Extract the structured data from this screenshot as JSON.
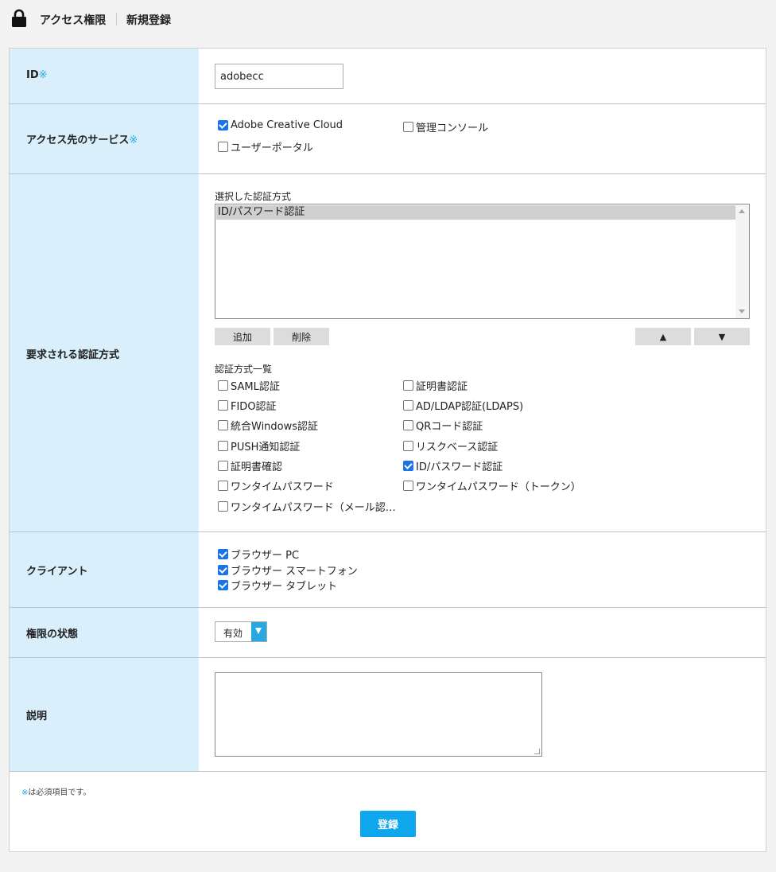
{
  "header": {
    "title": "アクセス権限",
    "subtitle": "新規登録"
  },
  "required_mark": "※",
  "id_row": {
    "label": "ID",
    "value": "adobecc"
  },
  "service_row": {
    "label": "アクセス先のサービス",
    "options": [
      {
        "label": "Adobe Creative Cloud",
        "checked": true
      },
      {
        "label": "管理コンソール",
        "checked": false
      },
      {
        "label": "ユーザーポータル",
        "checked": false
      }
    ]
  },
  "auth_row": {
    "label": "要求される認証方式",
    "selected_title": "選択した認証方式",
    "selected_items": [
      "ID/パスワード認証"
    ],
    "add_label": "追加",
    "delete_label": "削除",
    "up_label": "▲",
    "down_label": "▼",
    "list_title": "認証方式一覧",
    "methods": [
      {
        "label": "SAML認証",
        "checked": false
      },
      {
        "label": "証明書認証",
        "checked": false
      },
      {
        "label": "FIDO認証",
        "checked": false
      },
      {
        "label": "AD/LDAP認証(LDAPS)",
        "checked": false
      },
      {
        "label": "統合Windows認証",
        "checked": false
      },
      {
        "label": "QRコード認証",
        "checked": false
      },
      {
        "label": "PUSH通知認証",
        "checked": false
      },
      {
        "label": "リスクベース認証",
        "checked": false
      },
      {
        "label": "証明書確認",
        "checked": false
      },
      {
        "label": "ID/パスワード認証",
        "checked": true
      },
      {
        "label": "ワンタイムパスワード",
        "checked": false
      },
      {
        "label": "ワンタイムパスワード（トークン）",
        "checked": false
      },
      {
        "label": "ワンタイムパスワード（メール認…",
        "checked": false
      }
    ]
  },
  "client_row": {
    "label": "クライアント",
    "options": [
      {
        "label": "ブラウザー PC",
        "checked": true
      },
      {
        "label": "ブラウザー スマートフォン",
        "checked": true
      },
      {
        "label": "ブラウザー タブレット",
        "checked": true
      }
    ]
  },
  "status_row": {
    "label": "権限の状態",
    "value": "有効"
  },
  "desc_row": {
    "label": "説明"
  },
  "footer": {
    "note_mark": "※",
    "note_text": "は必須項目です。",
    "submit_label": "登録"
  }
}
